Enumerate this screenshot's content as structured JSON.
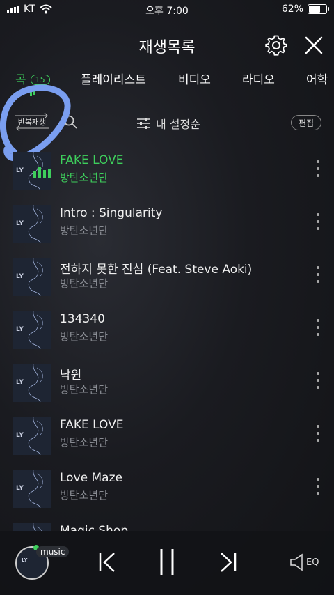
{
  "status_bar": {
    "carrier": "KT",
    "time": "오후 7:00",
    "battery_percent": "62%",
    "battery_level": 0.62
  },
  "header": {
    "title": "재생목록",
    "settings_icon": "gear-icon",
    "close_icon": "close-icon"
  },
  "tabs": [
    {
      "label": "곡",
      "badge": "15",
      "active": true
    },
    {
      "label": "플레이리스트"
    },
    {
      "label": "비디오"
    },
    {
      "label": "라디오"
    },
    {
      "label": "어학"
    }
  ],
  "toolbar": {
    "repeat_label": "반복재생",
    "sort_label": "내 설정순",
    "edit_label": "편집"
  },
  "songs": [
    {
      "title": "FAKE LOVE",
      "artist": "방탄소년단",
      "playing": true
    },
    {
      "title": "Intro : Singularity",
      "artist": "방탄소년단"
    },
    {
      "title": "전하지 못한 진심 (Feat. Steve Aoki)",
      "artist": "방탄소년단"
    },
    {
      "title": "134340",
      "artist": "방탄소년단"
    },
    {
      "title": "낙원",
      "artist": "방탄소년단"
    },
    {
      "title": "FAKE LOVE",
      "artist": "방탄소년단"
    },
    {
      "title": "Love Maze",
      "artist": "방탄소년단"
    },
    {
      "title": "Magic Shop",
      "artist": ""
    }
  ],
  "album_art_text": "LY",
  "player": {
    "music_tag": "music",
    "eq_label": "EQ"
  },
  "colors": {
    "accent_green": "#3ecf5c",
    "annotation_blue": "#7a9ef0"
  }
}
